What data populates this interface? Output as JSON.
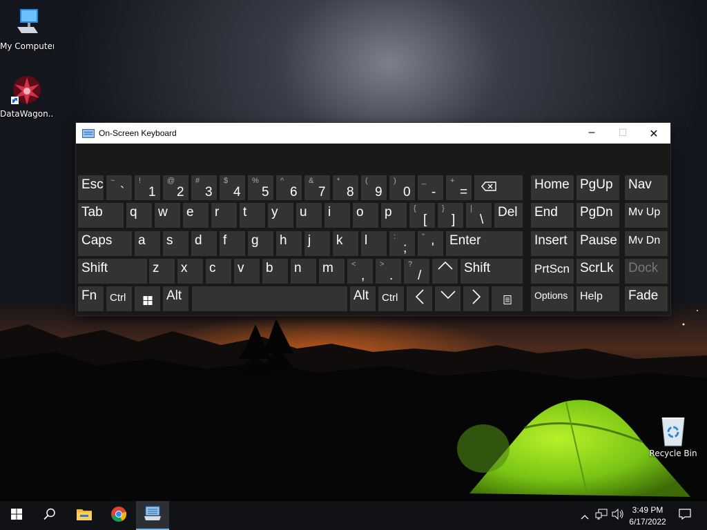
{
  "desktop": {
    "icons": [
      {
        "label": "My Computer",
        "icon": "computer-icon"
      },
      {
        "label": "DataWagon...",
        "icon": "app-shortcut-icon"
      },
      {
        "label": "Recycle Bin",
        "icon": "recycle-bin-icon"
      }
    ]
  },
  "osk": {
    "title": "On-Screen Keyboard",
    "controls": {
      "minimize": "─",
      "maximize": "☐",
      "close": "✕"
    },
    "keys": {
      "esc": "Esc",
      "tab": "Tab",
      "caps": "Caps",
      "shift_l": "Shift",
      "shift_r": "Shift",
      "fn": "Fn",
      "ctrl_l": "Ctrl",
      "ctrl_r": "Ctrl",
      "alt_l": "Alt",
      "alt_r": "Alt",
      "del": "Del",
      "enter": "Enter",
      "home": "Home",
      "pgup": "PgUp",
      "nav": "Nav",
      "end": "End",
      "pgdn": "PgDn",
      "mvup": "Mv Up",
      "insert": "Insert",
      "pause": "Pause",
      "mvdn": "Mv Dn",
      "prtscn": "PrtScn",
      "scrlk": "ScrLk",
      "dock": "Dock",
      "options": "Options",
      "help": "Help",
      "fade": "Fade",
      "num_row": [
        {
          "top": "~",
          "low": "`"
        },
        {
          "top": "!",
          "low": "1"
        },
        {
          "top": "@",
          "low": "2"
        },
        {
          "top": "#",
          "low": "3"
        },
        {
          "top": "$",
          "low": "4"
        },
        {
          "top": "%",
          "low": "5"
        },
        {
          "top": "^",
          "low": "6"
        },
        {
          "top": "&",
          "low": "7"
        },
        {
          "top": "*",
          "low": "8"
        },
        {
          "top": "(",
          "low": "9"
        },
        {
          "top": ")",
          "low": "0"
        },
        {
          "top": "_",
          "low": "-"
        },
        {
          "top": "+",
          "low": "="
        }
      ],
      "row_q": [
        "q",
        "w",
        "e",
        "r",
        "t",
        "y",
        "u",
        "i",
        "o",
        "p"
      ],
      "row_q_extra": [
        {
          "top": "{",
          "low": "["
        },
        {
          "top": "}",
          "low": "]"
        },
        {
          "top": "|",
          "low": "\\"
        }
      ],
      "row_a": [
        "a",
        "s",
        "d",
        "f",
        "g",
        "h",
        "j",
        "k",
        "l"
      ],
      "row_a_extra": [
        {
          "top": ":",
          "low": ";"
        },
        {
          "top": "\"",
          "low": "'"
        }
      ],
      "row_z": [
        "z",
        "x",
        "c",
        "v",
        "b",
        "n",
        "m"
      ],
      "row_z_extra": [
        {
          "top": "<",
          "low": ","
        },
        {
          "top": ">",
          "low": "."
        },
        {
          "top": "?",
          "low": "/"
        }
      ]
    }
  },
  "taskbar": {
    "time": "3:49 PM",
    "date": "6/17/2022"
  },
  "colors": {
    "key_bg": "#333333",
    "osk_bg": "#191919",
    "taskbar_bg": "#101215",
    "accent": "#76b9ed"
  }
}
